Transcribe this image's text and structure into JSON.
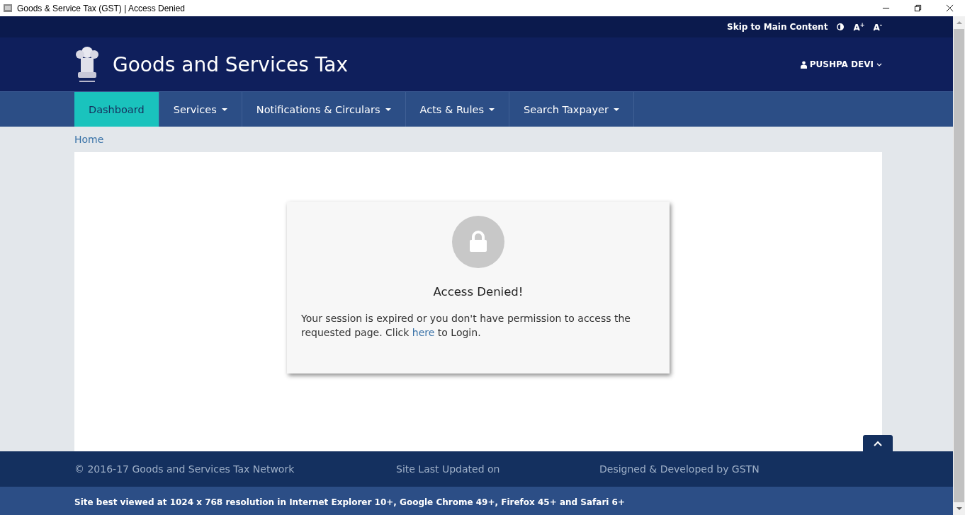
{
  "window": {
    "title": "Goods & Service Tax (GST) | Access Denied"
  },
  "top_bar": {
    "skip_link": "Skip to Main Content",
    "font_increase": "A$^{+}$",
    "font_decrease": "A$^{-}$"
  },
  "header": {
    "title": "Goods and Services Tax",
    "user": "PUSHPA DEVI"
  },
  "nav": [
    {
      "label": "Dashboard",
      "selected": true,
      "dropdown": false
    },
    {
      "label": "Services",
      "selected": false,
      "dropdown": true
    },
    {
      "label": "Notifications & Circulars",
      "selected": false,
      "dropdown": true
    },
    {
      "label": "Acts & Rules",
      "selected": false,
      "dropdown": true
    },
    {
      "label": "Search Taxpayer",
      "selected": false,
      "dropdown": true
    }
  ],
  "breadcrumb": [
    "Home"
  ],
  "dialog": {
    "title": "Access Denied!",
    "message_before": "Your session is expired or you don't have permission to access the requested page. Click",
    "link": "here",
    "message_after": "to Login."
  },
  "footer": {
    "columns": [
      "© 2016-17 Goods and Services Tax Network",
      "Site Last Updated on",
      "Designed & Developed by GSTN"
    ],
    "note": "Site best viewed at 1024 x 768 resolution in Internet Explorer 10+, Google Chrome 49+, Firefox 45+ and Safari 6+"
  }
}
